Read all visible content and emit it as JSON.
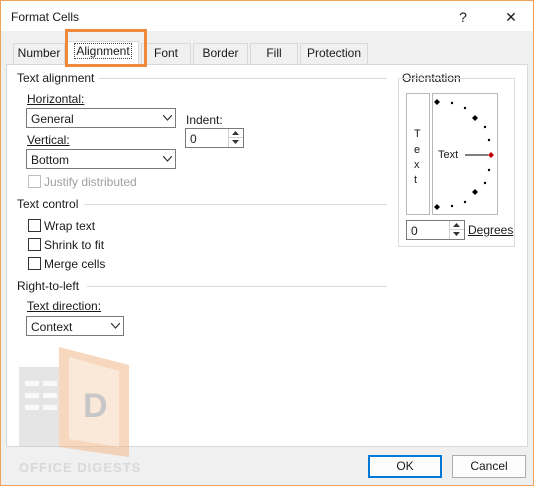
{
  "window": {
    "title": "Format Cells",
    "help_glyph": "?",
    "close_glyph": "✕"
  },
  "tabs": [
    {
      "label": "Number"
    },
    {
      "label": "Alignment"
    },
    {
      "label": "Font"
    },
    {
      "label": "Border"
    },
    {
      "label": "Fill"
    },
    {
      "label": "Protection"
    }
  ],
  "text_alignment": {
    "title": "Text alignment",
    "horizontal_label": "Horizontal:",
    "horizontal_value": "General",
    "vertical_label": "Vertical:",
    "vertical_value": "Bottom",
    "indent_label": "Indent:",
    "indent_value": "0",
    "justify_label": "Justify distributed"
  },
  "text_control": {
    "title": "Text control",
    "wrap_label": "Wrap text",
    "shrink_label": "Shrink to fit",
    "merge_label": "Merge cells"
  },
  "rtl": {
    "title": "Right-to-left",
    "direction_label": "Text direction:",
    "direction_value": "Context"
  },
  "orientation": {
    "title": "Orientation",
    "vertical_letters": [
      "T",
      "e",
      "x",
      "t"
    ],
    "dial_text": "Text",
    "degrees_value": "0",
    "degrees_label": "Degrees"
  },
  "buttons": {
    "ok": "OK",
    "cancel": "Cancel"
  },
  "watermark": {
    "text": "OFFICE DIGESTS"
  },
  "colors": {
    "highlight": "#ef8a3c",
    "accent": "#0078d7",
    "marker": "#c00000"
  }
}
